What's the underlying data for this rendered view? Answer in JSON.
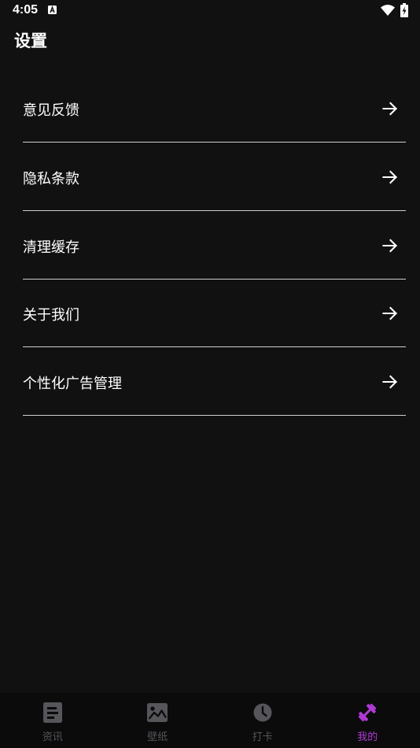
{
  "status_bar": {
    "time": "4:05",
    "notification_icon": "a-box-icon",
    "wifi_icon": "wifi-icon",
    "battery_icon": "battery-charging-icon"
  },
  "page": {
    "title": "设置"
  },
  "settings": {
    "items": [
      {
        "label": "意见反馈",
        "icon": "arrow-right-icon"
      },
      {
        "label": "隐私条款",
        "icon": "arrow-right-icon"
      },
      {
        "label": "清理缓存",
        "icon": "arrow-right-icon"
      },
      {
        "label": "关于我们",
        "icon": "arrow-right-icon"
      },
      {
        "label": "个性化广告管理",
        "icon": "arrow-right-icon"
      }
    ]
  },
  "bottom_nav": {
    "items": [
      {
        "label": "资讯",
        "icon": "article-icon",
        "active": false
      },
      {
        "label": "壁纸",
        "icon": "image-icon",
        "active": false
      },
      {
        "label": "打卡",
        "icon": "clock-icon",
        "active": false
      },
      {
        "label": "我的",
        "icon": "dumbbell-icon",
        "active": true
      }
    ]
  },
  "colors": {
    "background": "#111112",
    "nav_background": "#0b0b0c",
    "active_accent": "#b13ad6",
    "inactive": "#55555a",
    "divider": "#cfcfcf"
  }
}
